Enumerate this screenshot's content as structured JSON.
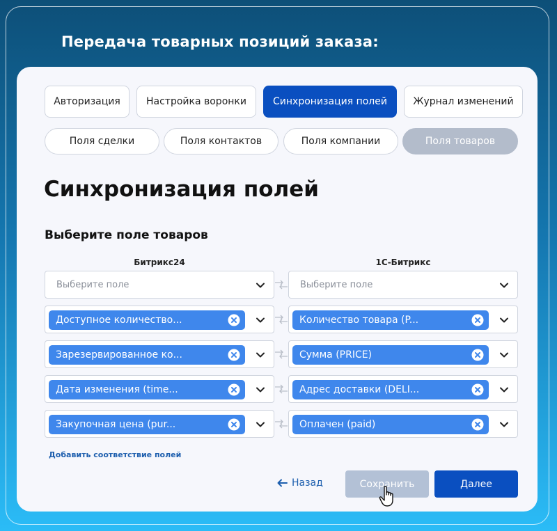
{
  "header": {
    "title": "Передача товарных позиций заказа:"
  },
  "tabs": [
    {
      "label": "Авторизация",
      "active": false
    },
    {
      "label": "Настройка воронки",
      "active": false
    },
    {
      "label": "Синхронизация полей",
      "active": true
    },
    {
      "label": "Журнал изменений",
      "active": false
    }
  ],
  "subtabs": [
    {
      "label": "Поля сделки",
      "active": false
    },
    {
      "label": "Поля контактов",
      "active": false
    },
    {
      "label": "Поля компании",
      "active": false
    },
    {
      "label": "Поля товаров",
      "active": true
    }
  ],
  "page_title": "Синхронизация полей",
  "section_title": "Выберите поле товаров",
  "columns": {
    "left": "Битрикс24",
    "right": "1С-Битрикс"
  },
  "mapping": {
    "placeholder_left": "Выберите поле",
    "placeholder_right": "Выберите поле",
    "rows": [
      {
        "left": "Доступное количество...",
        "right": "Количество товара (P..."
      },
      {
        "left": "Зарезервированное ко...",
        "right": "Сумма (PRICE)"
      },
      {
        "left": "Дата изменения (time...",
        "right": "Адрес доставки (DELI..."
      },
      {
        "left": "Закупочная цена (pur...",
        "right": "Оплачен (paid)"
      }
    ]
  },
  "add_link": "Добавить соответствие полей",
  "actions": {
    "back": "Назад",
    "save": "Сохранить",
    "next": "Далее"
  },
  "colors": {
    "accent": "#0a4fc0",
    "chip": "#3f87ec",
    "disabled": "#b3c1d6",
    "link": "#1e5fae"
  }
}
